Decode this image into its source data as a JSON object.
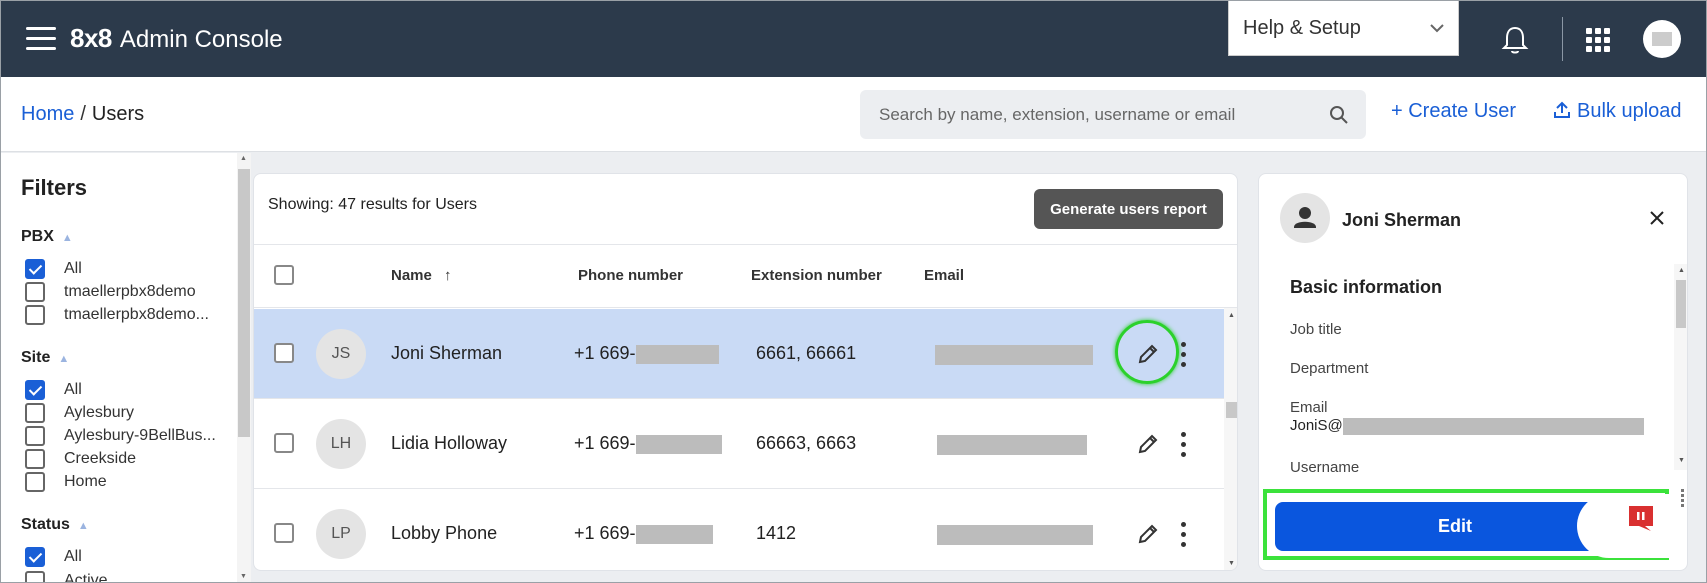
{
  "topbar": {
    "brand_bold": "8x8",
    "brand_text": "Admin Console",
    "help_label": "Help & Setup"
  },
  "header": {
    "breadcrumb_home": "Home",
    "breadcrumb_sep": "/",
    "breadcrumb_current": "Users",
    "search_placeholder": "Search by name, extension, username or email",
    "create_user": "+ Create User",
    "bulk_upload": "Bulk upload"
  },
  "filters": {
    "title": "Filters",
    "groups": [
      {
        "label": "PBX",
        "items": [
          {
            "label": "All",
            "checked": true
          },
          {
            "label": "tmaellerpbx8demo",
            "checked": false
          },
          {
            "label": "tmaellerpbx8demo...",
            "checked": false
          }
        ]
      },
      {
        "label": "Site",
        "items": [
          {
            "label": "All",
            "checked": true
          },
          {
            "label": "Aylesbury",
            "checked": false
          },
          {
            "label": "Aylesbury-9BellBus...",
            "checked": false
          },
          {
            "label": "Creekside",
            "checked": false
          },
          {
            "label": "Home",
            "checked": false
          }
        ]
      },
      {
        "label": "Status",
        "items": [
          {
            "label": "All",
            "checked": true
          },
          {
            "label": "Active",
            "checked": false
          }
        ]
      }
    ]
  },
  "table": {
    "showing": "Showing: 47 results for Users",
    "report_button": "Generate users report",
    "columns": {
      "name": "Name",
      "sort_arrow": "↑",
      "phone": "Phone number",
      "extension": "Extension number",
      "email": "Email"
    },
    "rows": [
      {
        "initials": "JS",
        "name": "Joni Sherman",
        "phone_prefix": "+1 669-",
        "extension": "6661, 66661",
        "selected": true
      },
      {
        "initials": "LH",
        "name": "Lidia Holloway",
        "phone_prefix": "+1 669-",
        "extension": "66663, 6663",
        "selected": false
      },
      {
        "initials": "LP",
        "name": "Lobby Phone",
        "phone_prefix": "+1 669-",
        "extension": "1412",
        "selected": false
      }
    ]
  },
  "panel": {
    "name": "Joni Sherman",
    "section": "Basic information",
    "job_title_label": "Job title",
    "department_label": "Department",
    "email_label": "Email",
    "email_prefix": "JoniS@",
    "username_label": "Username",
    "edit_button": "Edit"
  },
  "colors": {
    "topbar": "#2c3a4b",
    "accent": "#1a5fd6",
    "selected_row": "#c9daf5",
    "highlight": "#3be23b",
    "edit_button": "#0a56de"
  }
}
